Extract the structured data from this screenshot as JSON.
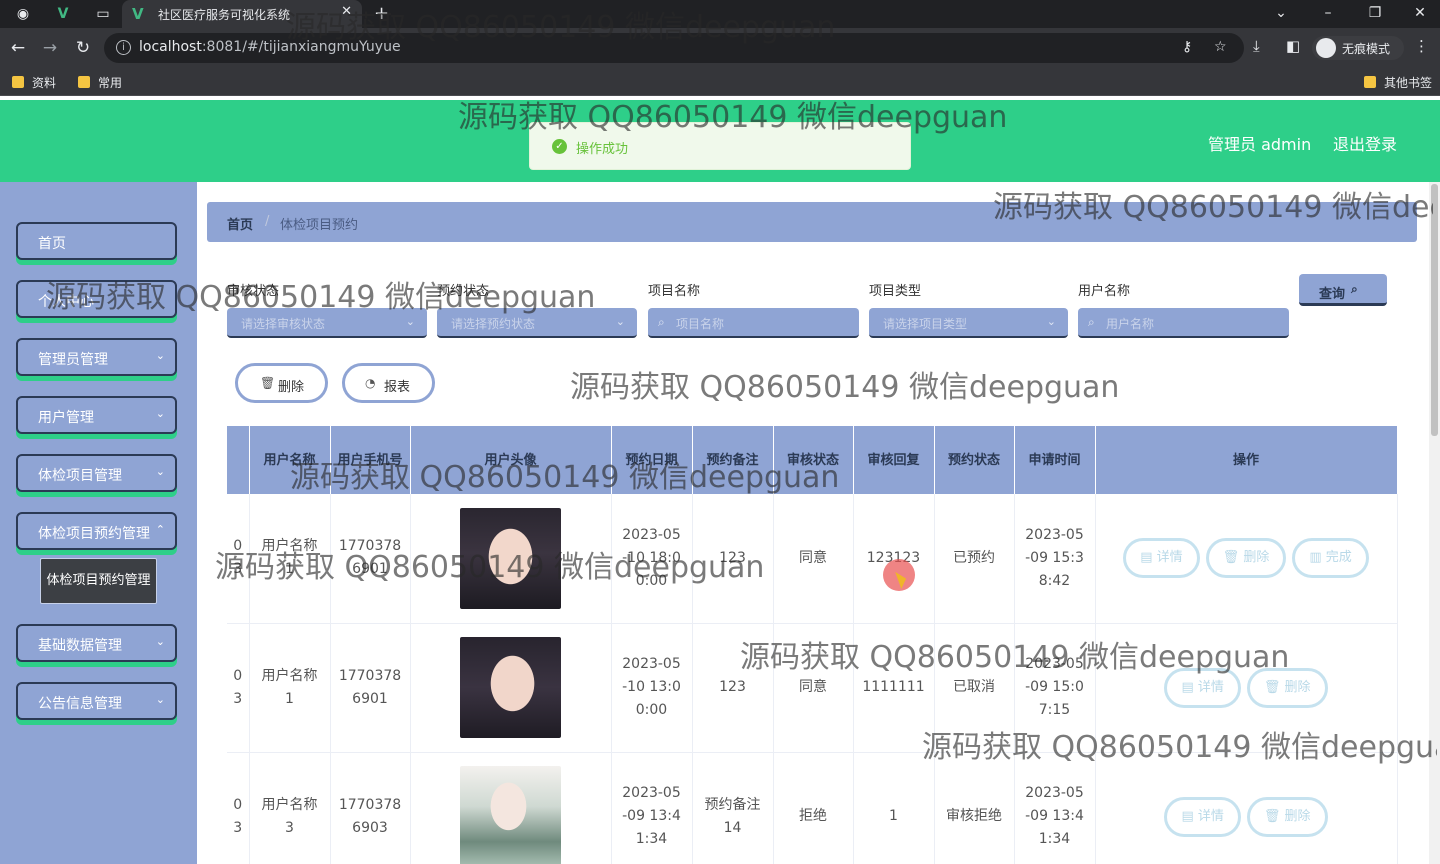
{
  "browser": {
    "tab_title": "社区医疗服务可视化系统",
    "url_host": "localhost",
    "url_rest": ":8081/#/tijianxiangmuYuyue",
    "incognito_label": "无痕模式",
    "bookmarks": [
      "资料",
      "常用"
    ],
    "other_bookmarks": "其他书签"
  },
  "header": {
    "user_label": "管理员 admin",
    "logout_label": "退出登录"
  },
  "toast": {
    "message": "操作成功",
    "color": "#67c23a"
  },
  "colors": {
    "header_green": "#2ecf89",
    "sidebar_blue": "#8fa4d4",
    "dark_border": "#2b3a55"
  },
  "sidebar": {
    "items": [
      {
        "label": "首页"
      },
      {
        "label": "个人中心"
      },
      {
        "label": "管理员管理"
      },
      {
        "label": "用户管理"
      },
      {
        "label": "体检项目管理"
      },
      {
        "label": "体检项目预约管理"
      },
      {
        "label": "基础数据管理"
      },
      {
        "label": "公告信息管理"
      }
    ],
    "submenu_active": "体检项目预约管理"
  },
  "breadcrumb": {
    "home": "首页",
    "current": "体检项目预约"
  },
  "filters": {
    "audit_status": {
      "label": "审核状态",
      "placeholder": "请选择审核状态"
    },
    "booking_status": {
      "label": "预约状态",
      "placeholder": "请选择预约状态"
    },
    "project_name": {
      "label": "项目名称",
      "placeholder": "项目名称"
    },
    "project_type": {
      "label": "项目类型",
      "placeholder": "请选择项目类型"
    },
    "user_name": {
      "label": "用户名称",
      "placeholder": "用户名称"
    },
    "query_label": "查询"
  },
  "actions": {
    "delete_label": "删除",
    "report_label": "报表"
  },
  "table": {
    "headers": [
      "",
      "用户名称",
      "用户手机号",
      "用户头像",
      "预约日期",
      "预约备注",
      "审核状态",
      "审核回复",
      "预约状态",
      "申请时间",
      "操作"
    ],
    "rows": [
      {
        "id": "0\n3",
        "user": "用户名称\n1",
        "phone": "1770378\n6901",
        "date": "2023-05\n-10 18:0\n0:00",
        "remark": "123",
        "audit": "同意",
        "reply": "123123",
        "status": "已预约",
        "applied": "2023-05\n-09 15:3\n8:42",
        "ops": [
          "详情",
          "删除",
          "完成"
        ]
      },
      {
        "id": "0\n3",
        "user": "用户名称\n1",
        "phone": "1770378\n6901",
        "date": "2023-05\n-10 13:0\n0:00",
        "remark": "123",
        "audit": "同意",
        "reply": "1111111",
        "status": "已取消",
        "applied": "2023-05\n-09 15:0\n7:15",
        "ops": [
          "详情",
          "删除"
        ]
      },
      {
        "id": "0\n3",
        "user": "用户名称\n3",
        "phone": "1770378\n6903",
        "date": "2023-05\n-09 13:4\n1:34",
        "remark": "预约备注\n14",
        "audit": "拒绝",
        "reply": "1",
        "status": "审核拒绝",
        "applied": "2023-05\n-09 13:4\n1:34",
        "ops": [
          "详情",
          "删除"
        ]
      }
    ]
  },
  "watermark": "源码获取 QQ86050149 微信deepguan"
}
